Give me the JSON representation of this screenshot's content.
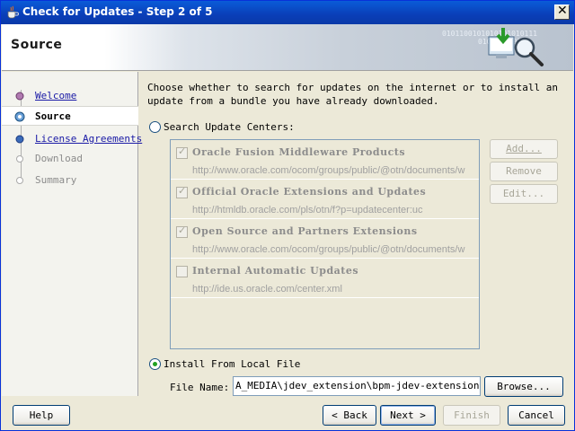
{
  "window": {
    "title": "Check for Updates - Step 2 of 5",
    "close_glyph": "✕"
  },
  "header": {
    "title": "Source",
    "binary": [
      "0101100101010101010111",
      "01010101010",
      "0101"
    ]
  },
  "nav": {
    "items": [
      {
        "label": "Welcome",
        "state": "link"
      },
      {
        "label": "Source",
        "state": "current"
      },
      {
        "label": "License Agreements",
        "state": "link"
      },
      {
        "label": "Download",
        "state": "disabled"
      },
      {
        "label": "Summary",
        "state": "disabled"
      }
    ]
  },
  "main": {
    "intro": "Choose whether to search for updates on the internet or to install an update from a bundle you have already downloaded.",
    "search_option": {
      "label": "Search Update Centers:",
      "checked": false
    },
    "update_centers": [
      {
        "name": "Oracle Fusion Middleware Products",
        "url": "http://www.oracle.com/ocom/groups/public/@otn/documents/w",
        "checked": true
      },
      {
        "name": "Official Oracle Extensions and Updates",
        "url": "http://htmldb.oracle.com/pls/otn/f?p=updatecenter:uc",
        "checked": true
      },
      {
        "name": "Open Source and Partners Extensions",
        "url": "http://www.oracle.com/ocom/groups/public/@otn/documents/w",
        "checked": true
      },
      {
        "name": "Internal Automatic Updates",
        "url": "http://ide.us.oracle.com/center.xml",
        "checked": false
      }
    ],
    "side_buttons": {
      "add": "Add...",
      "remove": "Remove",
      "edit": "Edit..."
    },
    "local_option": {
      "label": "Install From Local File",
      "checked": true
    },
    "file_name_label": "File Name:",
    "file_name_value": "A_MEDIA\\jdev_extension\\bpm-jdev-extension.zip",
    "browse_button": "Browse..."
  },
  "footer": {
    "help": "Help",
    "back": "< Back",
    "next": "Next >",
    "finish": "Finish",
    "cancel": "Cancel"
  },
  "colors": {
    "title_bar": "#0a3eb8",
    "link": "#1a1aa6",
    "disabled_text": "#8c8c8c",
    "radio_selected": "#21a121"
  }
}
